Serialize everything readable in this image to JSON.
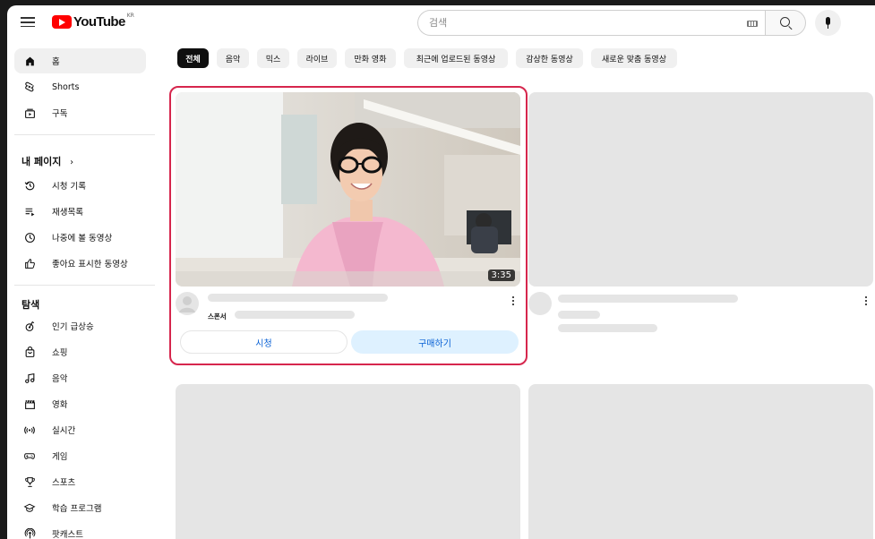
{
  "header": {
    "logo_text": "YouTube",
    "region": "KR",
    "search_placeholder": "검색"
  },
  "sidebar": {
    "main": [
      {
        "label": "홈",
        "icon": "home-icon",
        "active": true
      },
      {
        "label": "Shorts",
        "icon": "shorts-icon"
      },
      {
        "label": "구독",
        "icon": "subscriptions-icon"
      }
    ],
    "my_title": "내 페이지",
    "my": [
      {
        "label": "시청 기록",
        "icon": "history-icon"
      },
      {
        "label": "재생목록",
        "icon": "playlist-icon"
      },
      {
        "label": "나중에 볼 동영상",
        "icon": "watch-later-icon"
      },
      {
        "label": "좋아요 표시한 동영상",
        "icon": "liked-icon"
      }
    ],
    "explore_title": "탐색",
    "explore": [
      {
        "label": "인기 급상승",
        "icon": "trending-icon"
      },
      {
        "label": "쇼핑",
        "icon": "shopping-icon"
      },
      {
        "label": "음악",
        "icon": "music-icon"
      },
      {
        "label": "영화",
        "icon": "movies-icon"
      },
      {
        "label": "실시간",
        "icon": "live-icon"
      },
      {
        "label": "게임",
        "icon": "gaming-icon"
      },
      {
        "label": "스포츠",
        "icon": "sports-icon"
      },
      {
        "label": "학습 프로그램",
        "icon": "learning-icon"
      },
      {
        "label": "팟캐스트",
        "icon": "podcast-icon"
      }
    ]
  },
  "chips": [
    "전체",
    "음악",
    "믹스",
    "라이브",
    "만화 영화",
    "최근에 업로드된 동영상",
    "감상한 동영상",
    "새로운 맞춤 동영상"
  ],
  "video": {
    "duration": "3:35",
    "sponsor_label": "스폰서",
    "watch_label": "시청",
    "buy_label": "구매하기"
  },
  "colors": {
    "highlight": "#d6264d",
    "brand_red": "#ff0000",
    "link_blue": "#065fd4"
  }
}
